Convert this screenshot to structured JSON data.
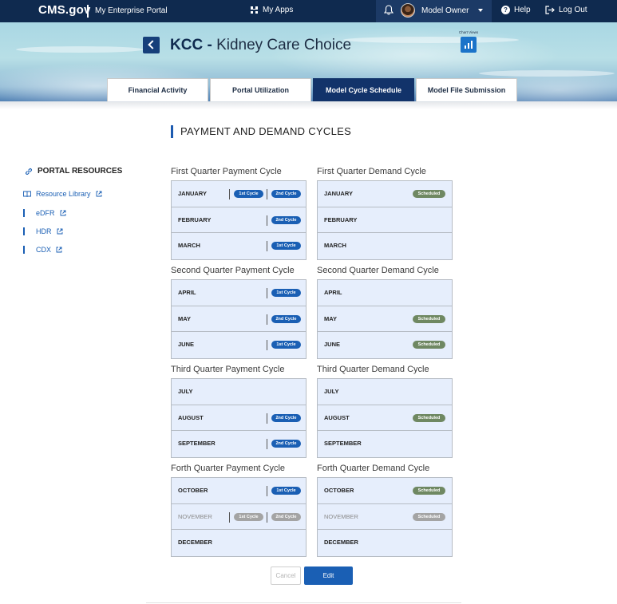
{
  "topbar": {
    "brand": "CMS.gov",
    "portal_name": "My Enterprise Portal",
    "my_apps": "My Apps",
    "user_name": "Model Owner",
    "help": "Help",
    "logout": "Log Out"
  },
  "banner": {
    "title_abbr": "KCC -",
    "title_name": "Kidney Care Choice",
    "chart_views_label": "Chart Views"
  },
  "tabs": [
    {
      "label": "Financial Activity",
      "active": false
    },
    {
      "label": "Portal Utilization",
      "active": false
    },
    {
      "label": "Model Cycle Schedule",
      "active": true
    },
    {
      "label": "Model File Submission",
      "active": false
    }
  ],
  "section_heading": "PAYMENT AND DEMAND CYCLES",
  "sidebar": {
    "heading": "PORTAL RESOURCES",
    "links": [
      "Resource Library",
      "eDFR",
      "HDR",
      "CDX"
    ]
  },
  "quarters": [
    {
      "payment_title": "First Quarter Payment Cycle",
      "demand_title": "First Quarter Demand Cycle",
      "months": [
        "JANUARY",
        "FEBRUARY",
        "MARCH"
      ],
      "payment_pills": [
        [
          "1st Cycle",
          "2nd Cycle"
        ],
        [
          "2nd Cycle"
        ],
        [
          "1st Cycle"
        ]
      ],
      "demand_pills": [
        "Scheduled",
        "",
        ""
      ]
    },
    {
      "payment_title": "Second Quarter Payment Cycle",
      "demand_title": "Second Quarter Demand Cycle",
      "months": [
        "APRIL",
        "MAY",
        "JUNE"
      ],
      "payment_pills": [
        [
          "1st Cycle"
        ],
        [
          "2nd Cycle"
        ],
        [
          "1st Cycle"
        ]
      ],
      "demand_pills": [
        "",
        "Scheduled",
        "Scheduled"
      ]
    },
    {
      "payment_title": "Third Quarter Payment Cycle",
      "demand_title": "Third Quarter Demand Cycle",
      "months": [
        "JULY",
        "AUGUST",
        "SEPTEMBER"
      ],
      "payment_pills": [
        [],
        [
          "2nd Cycle"
        ],
        [
          "2nd Cycle"
        ]
      ],
      "demand_pills": [
        "",
        "Scheduled",
        ""
      ]
    },
    {
      "payment_title": "Forth Quarter Payment Cycle",
      "demand_title": "Forth Quarter Demand Cycle",
      "months": [
        "OCTOBER",
        "NOVEMBER",
        "DECEMBER"
      ],
      "payment_pills": [
        [
          "1st Cycle"
        ],
        [
          "1st Cycle",
          "2nd Cycle"
        ],
        []
      ],
      "demand_pills": [
        "Scheduled",
        "Scheduled",
        ""
      ]
    }
  ],
  "buttons": {
    "cancel": "Cancel",
    "edit": "Edit"
  },
  "colors": {
    "topbar": "#0f2a4f",
    "active_tab": "#12336a",
    "cycle_pill": "#1a5fb4",
    "scheduled_pill": "#6f8862",
    "disabled_pill": "#a4a4a4",
    "cycle_box_bg": "#e6eefc"
  }
}
